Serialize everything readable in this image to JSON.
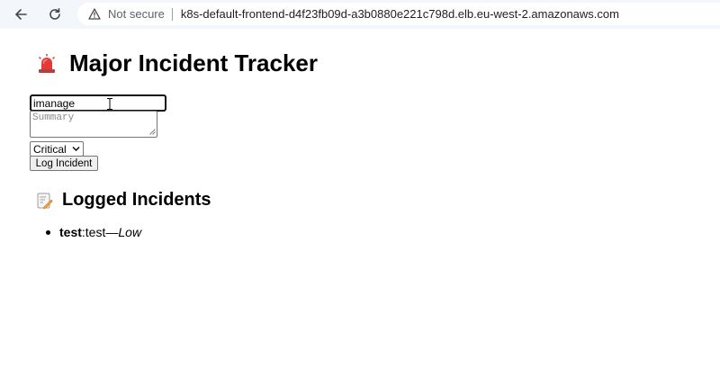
{
  "browser": {
    "security_label": "Not secure",
    "url": "k8s-default-frontend-d4f23fb09d-a3b0880e221c798d.elb.eu-west-2.amazonaws.com",
    "icons": [
      "back-arrow-icon",
      "reload-icon",
      "warning-icon"
    ]
  },
  "app": {
    "title": "Major Incident Tracker",
    "title_icon": "siren-icon"
  },
  "form": {
    "title_value": "imanage",
    "summary_placeholder": "Summary",
    "severity_selected": "Critical",
    "submit_label": "Log Incident"
  },
  "incidents_section": {
    "title": "Logged Incidents",
    "title_icon": "memo-icon",
    "items": [
      {
        "title": "test",
        "separator": ": ",
        "summary": "test",
        "dash": " — ",
        "severity": "Low"
      }
    ]
  },
  "colors": {
    "browser_bar": "#f3f6fb",
    "siren_red": "#e53935"
  }
}
